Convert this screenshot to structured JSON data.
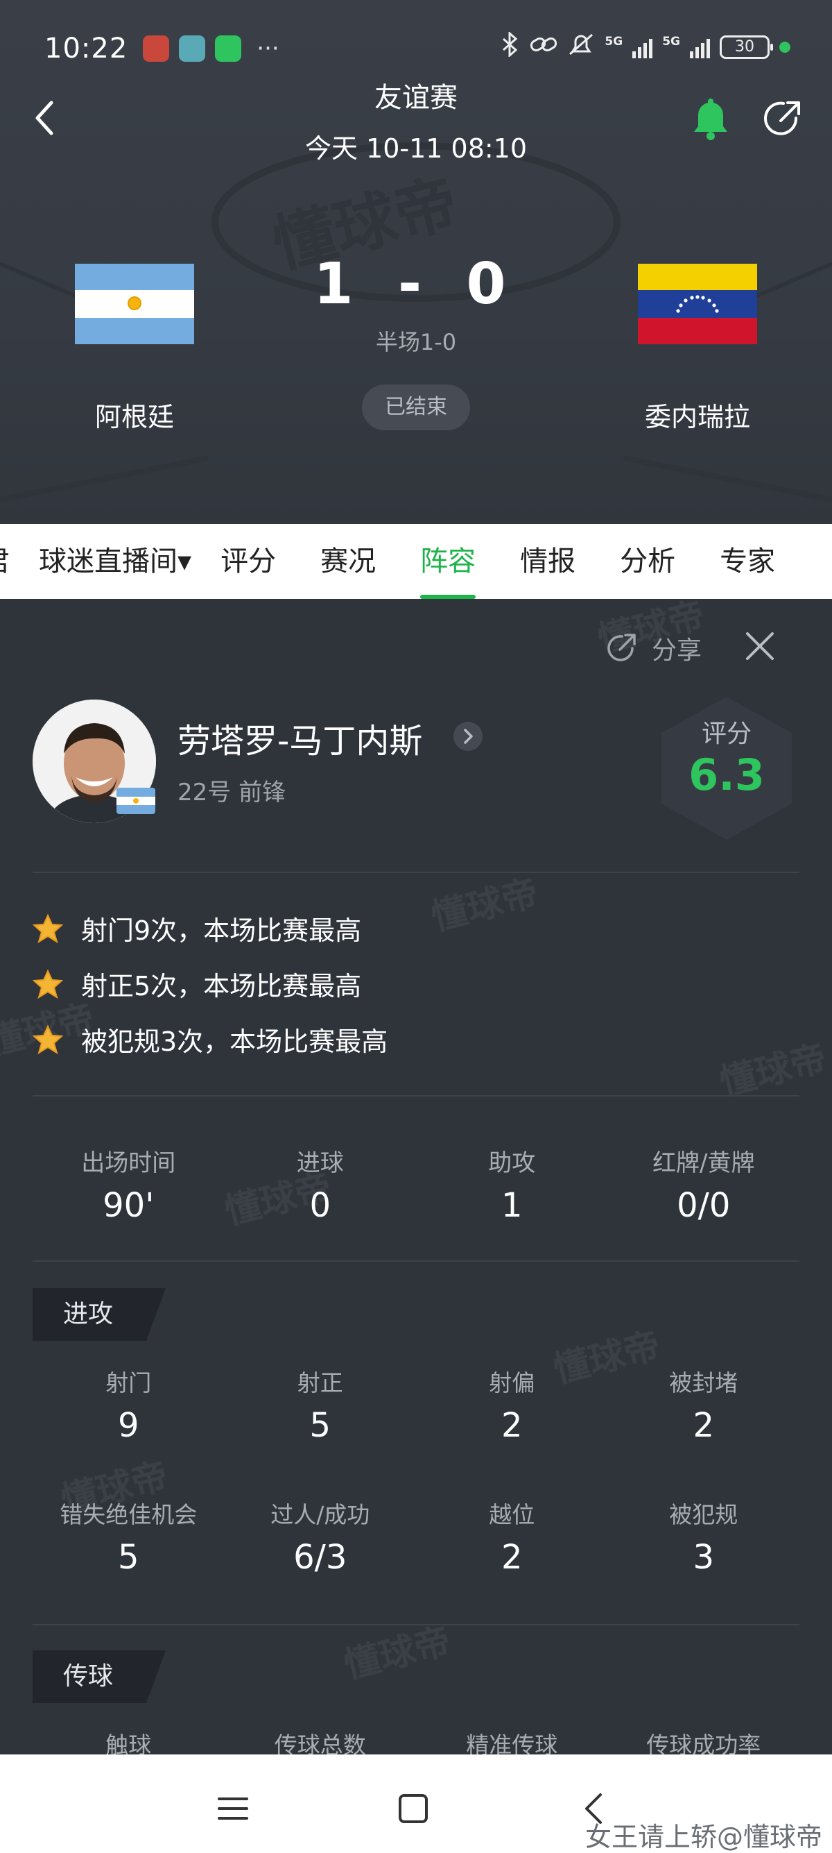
{
  "status_bar": {
    "time": "10:22",
    "more": "···",
    "battery": "30",
    "net1": "5G",
    "net2": "5G"
  },
  "header": {
    "title": "友谊赛",
    "date": "今天 10-11 08:10",
    "home_team": "阿根廷",
    "away_team": "委内瑞拉",
    "score": "1 - 0",
    "halftime": "半场1-0",
    "status": "已结束",
    "watermark": "懂球帝"
  },
  "tabs": [
    {
      "label": "君",
      "active": false
    },
    {
      "label": "球迷直播间▾",
      "active": false
    },
    {
      "label": "评分",
      "active": false
    },
    {
      "label": "赛况",
      "active": false
    },
    {
      "label": "阵容",
      "active": true
    },
    {
      "label": "情报",
      "active": false
    },
    {
      "label": "分析",
      "active": false
    },
    {
      "label": "专家",
      "active": false
    }
  ],
  "player": {
    "share_label": "分享",
    "name": "劳塔罗-马丁内斯",
    "sub": "22号 前锋",
    "rating_label": "评分",
    "rating": "6.3",
    "highlights": [
      "射门9次，本场比赛最高",
      "射正5次，本场比赛最高",
      "被犯规3次，本场比赛最高"
    ],
    "summary": [
      {
        "label": "出场时间",
        "value": "90'"
      },
      {
        "label": "进球",
        "value": "0"
      },
      {
        "label": "助攻",
        "value": "1"
      },
      {
        "label": "红牌/黄牌",
        "value": "0/0"
      }
    ]
  },
  "attack": {
    "title": "进攻",
    "rows": [
      [
        {
          "label": "射门",
          "value": "9"
        },
        {
          "label": "射正",
          "value": "5"
        },
        {
          "label": "射偏",
          "value": "2"
        },
        {
          "label": "被封堵",
          "value": "2"
        }
      ],
      [
        {
          "label": "错失绝佳机会",
          "value": "5"
        },
        {
          "label": "过人/成功",
          "value": "6/3"
        },
        {
          "label": "越位",
          "value": "2"
        },
        {
          "label": "被犯规",
          "value": "3"
        }
      ]
    ]
  },
  "passing": {
    "title": "传球",
    "labels": [
      "触球",
      "传球总数",
      "精准传球",
      "传球成功率"
    ]
  },
  "watermark_text": "懂球帝",
  "footer_credit": "女王请上轿@懂球帝",
  "colors": {
    "accent_green": "#20b34a",
    "rating_green": "#2ec45e",
    "background": "#2f343b"
  }
}
